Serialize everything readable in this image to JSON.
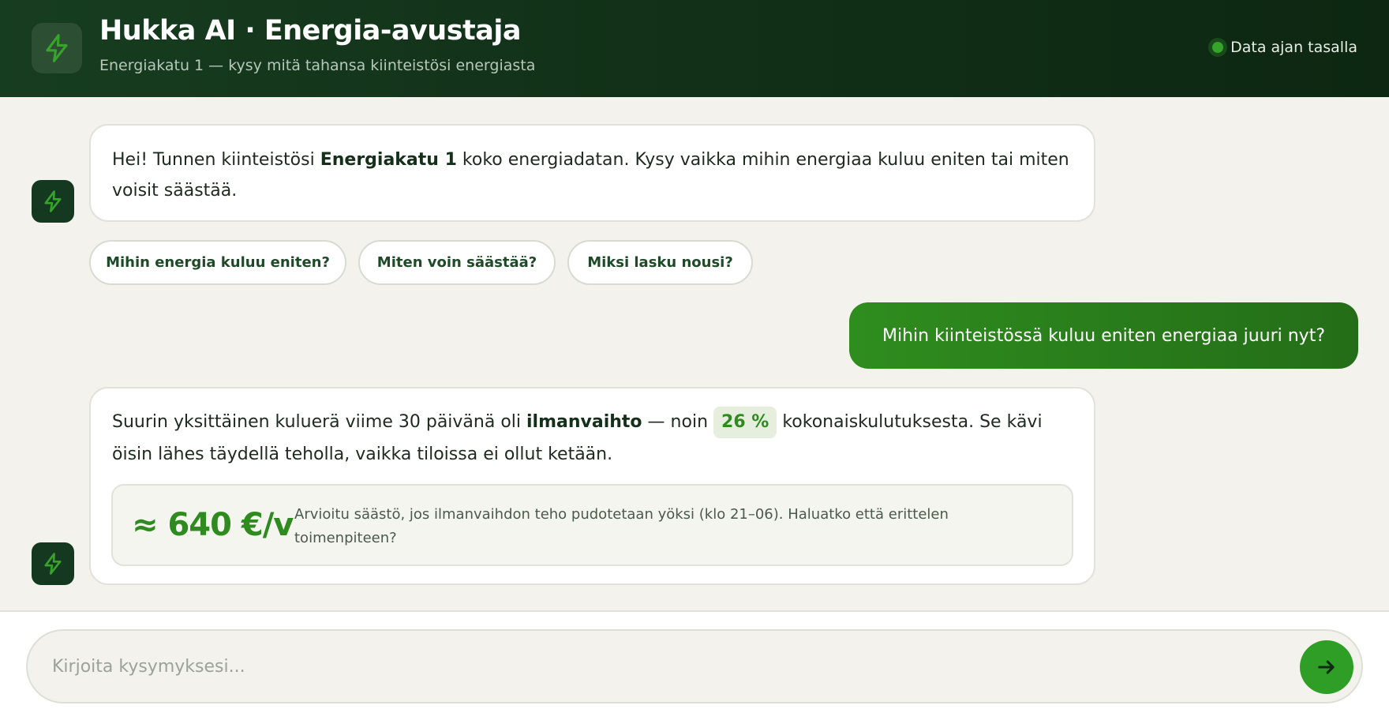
{
  "app": {
    "title": "Hukka AI · Energia-avustaja",
    "subtitle": "Energiakatu 1 — kysy mitä tahansa kiinteistösi energiasta",
    "status_label": "Data ajan tasalla",
    "icon": "lightning-bolt-icon",
    "colors": {
      "header_bg": "#143520",
      "accent": "#2f8b1f",
      "status": "#36a32c"
    }
  },
  "messages": {
    "greeting": {
      "part1": "Hei! Tunnen kiinteistösi ",
      "bold": "Energiakatu 1",
      "part2": " koko energiadatan. Kysy vaikka mihin energiaa kuluu eniten tai miten voisit säästää."
    },
    "suggestions": [
      "Mihin energia kuluu eniten?",
      "Miten voin säästää?",
      "Miksi lasku nousi?"
    ],
    "user_question": "Mihin kiinteistössä kuluu eniten energiaa juuri nyt?",
    "answer": {
      "part1": "Suurin yksittäinen kuluerä viime 30 päivänä oli ",
      "bold": "ilmanvaihto",
      "part2": " — noin ",
      "percent": "26 %",
      "part3": " kokonaiskulutuksesta. Se kävi öisin lähes täydellä teholla, vaikka tiloissa ei ollut ketään."
    },
    "savings": {
      "value": "≈ 640 €/v",
      "description": "Arvioitu säästö, jos ilmanvaihdon teho pudotetaan yöksi (klo 21–06). Haluatko että erittelen toimenpiteen?"
    }
  },
  "input": {
    "placeholder": "Kirjoita kysymyksesi...",
    "value": "",
    "send_icon": "arrow-right-icon"
  }
}
